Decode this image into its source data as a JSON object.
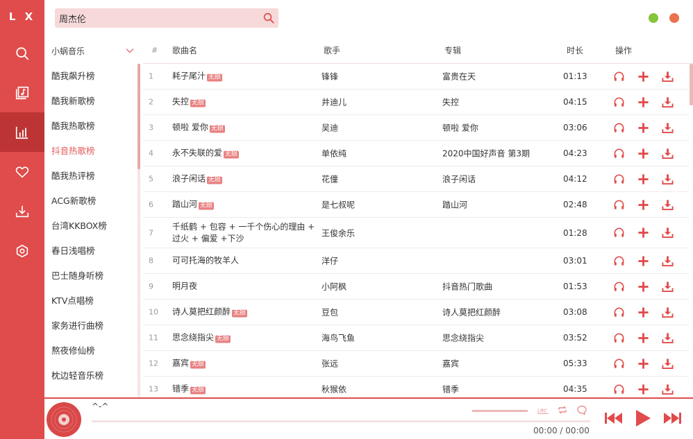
{
  "app": {
    "logo": "L X"
  },
  "nav": {
    "items": [
      {
        "name": "search",
        "icon": "search-icon"
      },
      {
        "name": "songlist",
        "icon": "music-folder-icon"
      },
      {
        "name": "leaderboard",
        "icon": "bar-chart-icon",
        "active": true
      },
      {
        "name": "favorite",
        "icon": "heart-icon"
      },
      {
        "name": "download",
        "icon": "download-icon"
      },
      {
        "name": "settings",
        "icon": "hexagon-settings-icon"
      }
    ]
  },
  "search": {
    "value": "周杰伦",
    "placeholder": ""
  },
  "window": {
    "min_color": "#85c43b",
    "close_color": "#e9734f"
  },
  "source": {
    "selected": "小蜗音乐"
  },
  "boards": [
    "酷我飙升榜",
    "酷我新歌榜",
    "酷我热歌榜",
    "抖音热歌榜",
    "酷我热评榜",
    "ACG新歌榜",
    "台湾KKBOX榜",
    "春日浅唱榜",
    "巴士随身听榜",
    "KTV点唱榜",
    "家务进行曲榜",
    "熬夜修仙榜",
    "枕边轻音乐榜"
  ],
  "active_board": 3,
  "table": {
    "headers": {
      "idx": "#",
      "name": "歌曲名",
      "singer": "歌手",
      "album": "专辑",
      "time": "时长",
      "ops": "操作"
    },
    "rows": [
      {
        "idx": "1",
        "name": "耗子尾汁",
        "badge": "无损",
        "singer": "锋锋",
        "album": "富贵在天",
        "time": "01:13"
      },
      {
        "idx": "2",
        "name": "失控",
        "badge": "无损",
        "singer": "井迪儿",
        "album": "失控",
        "time": "04:15"
      },
      {
        "idx": "3",
        "name": "顿啦 爱你",
        "badge": "无损",
        "singer": "吴迪",
        "album": "顿啦 爱你",
        "time": "03:06"
      },
      {
        "idx": "4",
        "name": "永不失联的爱",
        "badge": "无损",
        "singer": "单依纯",
        "album": "2020中国好声音 第3期",
        "time": "04:23"
      },
      {
        "idx": "5",
        "name": "浪子闲话",
        "badge": "无损",
        "singer": "花僮",
        "album": "浪子闲话",
        "time": "04:12"
      },
      {
        "idx": "6",
        "name": "踏山河",
        "badge": "无损",
        "singer": "是七叔呢",
        "album": "踏山河",
        "time": "02:48"
      },
      {
        "idx": "7",
        "name": "千纸鹤 + 包容 + 一千个伤心的理由 + 过火 + 偏爱 +下沙",
        "badge": "",
        "singer": "王俊余乐",
        "album": "",
        "time": "01:28"
      },
      {
        "idx": "8",
        "name": "可可托海的牧羊人",
        "badge": "",
        "singer": "洋仔",
        "album": "",
        "time": "03:01"
      },
      {
        "idx": "9",
        "name": "明月夜",
        "badge": "",
        "singer": "小阿枫",
        "album": "抖音热门歌曲",
        "time": "01:53"
      },
      {
        "idx": "10",
        "name": "诗人莫把红颜醉",
        "badge": "无损",
        "singer": "豆包",
        "album": "诗人莫把红颜醉",
        "time": "03:08"
      },
      {
        "idx": "11",
        "name": "思念绕指尖",
        "badge": "无损",
        "singer": "海鸟飞鱼",
        "album": "思念绕指尖",
        "time": "03:52"
      },
      {
        "idx": "12",
        "name": "嘉宾",
        "badge": "无损",
        "singer": "张远",
        "album": "嘉宾",
        "time": "05:33"
      },
      {
        "idx": "13",
        "name": "错季",
        "badge": "无损",
        "singer": "秋猴依",
        "album": "错季",
        "time": "04:35"
      }
    ]
  },
  "player": {
    "title": "^-^",
    "current": "00:00",
    "sep": "/",
    "total": "00:00",
    "lrc_label": "LRC",
    "accent": "#e04b4b"
  }
}
